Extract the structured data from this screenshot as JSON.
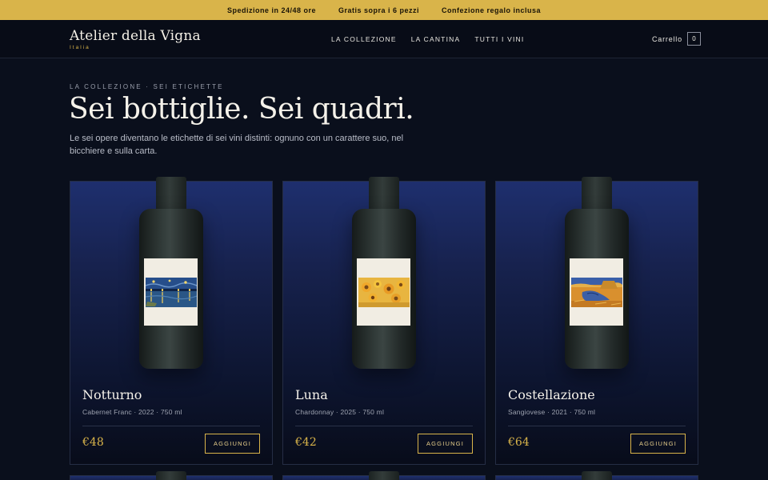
{
  "announcement": {
    "items": [
      "Spedizione in 24/48 ore",
      "Gratis sopra i 6 pezzi",
      "Confezione regalo inclusa"
    ]
  },
  "header": {
    "brand": "Atelier della Vigna",
    "brand_sub": "Italia",
    "nav": [
      "LA COLLEZIONE",
      "LA CANTINA",
      "TUTTI I VINI"
    ],
    "cart_label": "Carrello",
    "cart_count": "0"
  },
  "hero": {
    "eyebrow": "LA COLLEZIONE · SEI ETICHETTE",
    "title": "Sei bottiglie. Sei quadri.",
    "lead": "Le sei opere diventano le etichette di sei vini distinti: ognuno con un carattere suo, nel bicchiere e sulla carta."
  },
  "wines": [
    {
      "name": "Notturno",
      "meta": "Cabernet Franc · 2022 · 750 ml",
      "price": "€48",
      "cta": "AGGIUNGI",
      "label_art": "starry-river-night"
    },
    {
      "name": "Luna",
      "meta": "Chardonnay · 2025 · 750 ml",
      "price": "€42",
      "cta": "AGGIUNGI",
      "label_art": "sunflowers"
    },
    {
      "name": "Costellazione",
      "meta": "Sangiovese · 2021 · 750 ml",
      "price": "€64",
      "cta": "AGGIUNGI",
      "label_art": "noon-rest"
    }
  ],
  "colors": {
    "accent": "#d9b44a",
    "background": "#0a0f1c",
    "card_top": "#1e2f6e",
    "bottle": "#2d3634"
  }
}
